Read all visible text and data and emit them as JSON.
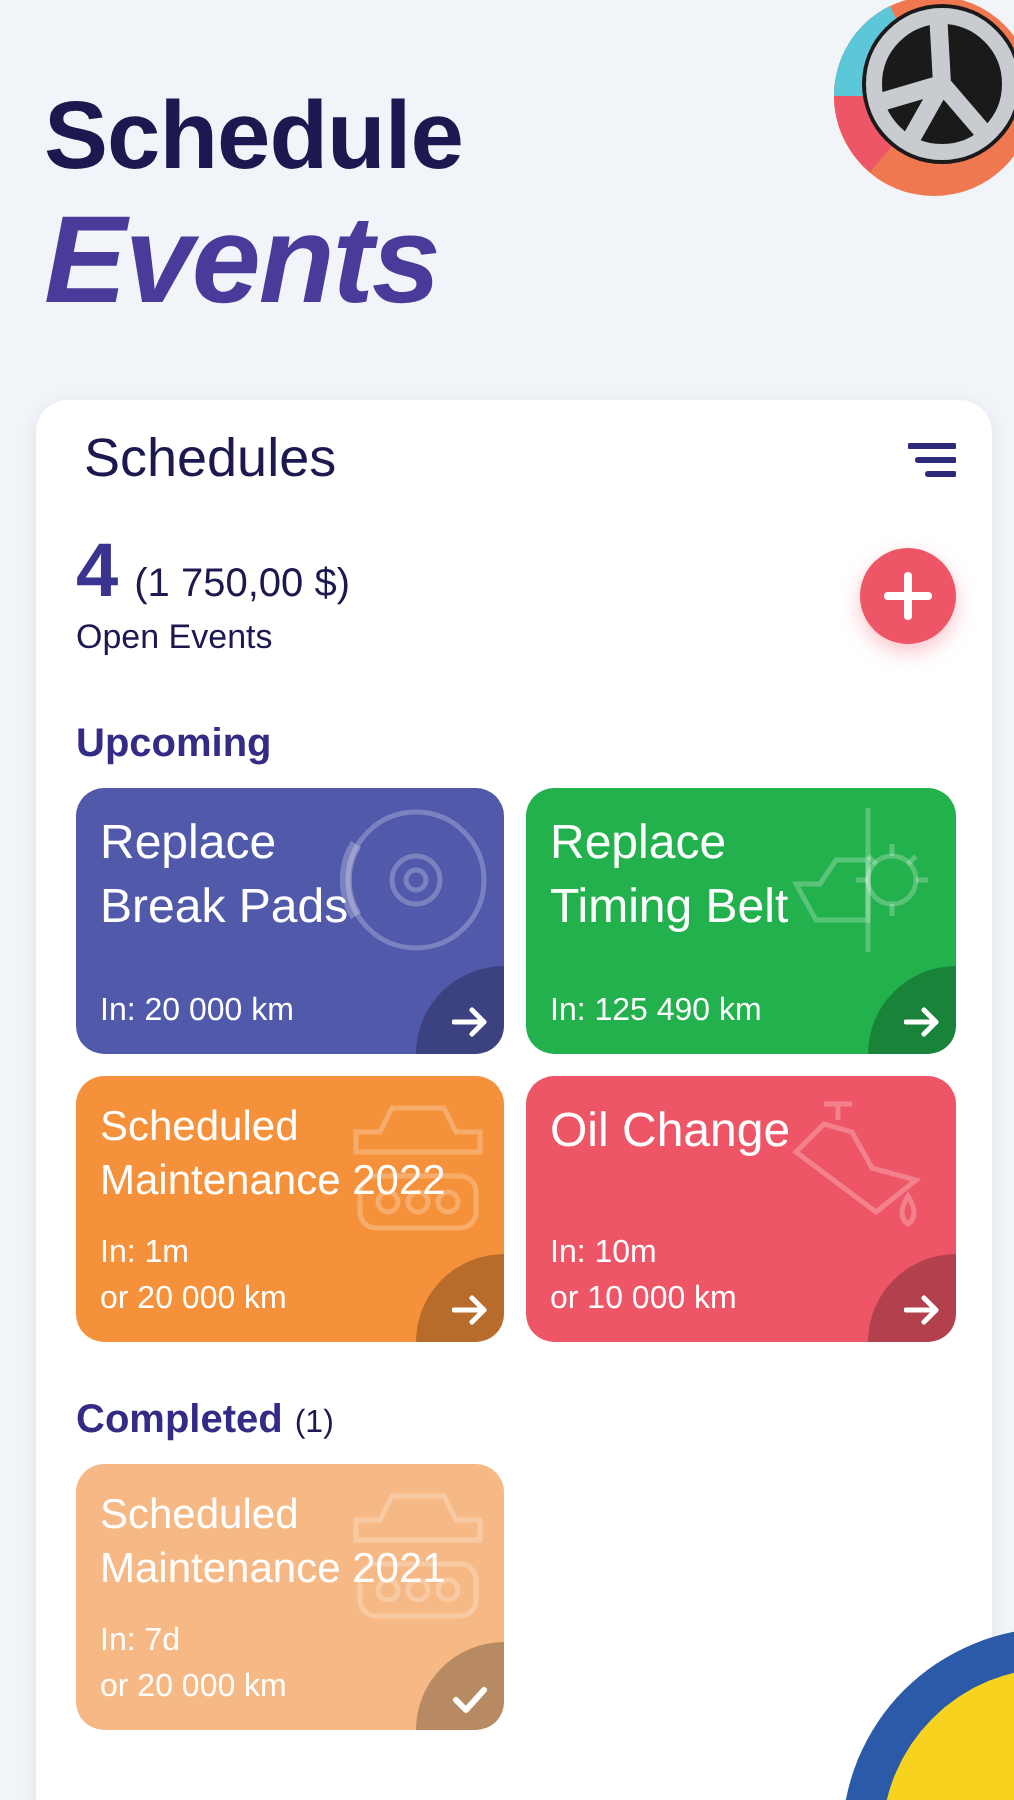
{
  "hero": {
    "line_1": "Schedule",
    "line_2": "Events"
  },
  "panel": {
    "title": "Schedules",
    "count": "4",
    "amount": "(1 750,00 $)",
    "count_label": "Open Events"
  },
  "upcoming": {
    "title": "Upcoming",
    "cards": [
      {
        "kind": "brakes",
        "title": "Replace\nBreak Pads",
        "detail": "In: 20 000 km",
        "color": "#5159ab",
        "done": false
      },
      {
        "kind": "timing",
        "title": "Replace\nTiming Belt",
        "detail": "In: 125 490 km",
        "color": "#22b14c",
        "done": false
      },
      {
        "kind": "maintenance",
        "title": "Scheduled\nMaintenance 2022",
        "detail": "In: 1m\nor 20 000 km",
        "color": "#f5913a",
        "done": false
      },
      {
        "kind": "oil",
        "title": "Oil Change",
        "detail": "In: 10m\nor 10 000 km",
        "color": "#ee5667",
        "done": false
      }
    ]
  },
  "completed": {
    "title": "Completed",
    "count": "(1)",
    "cards": [
      {
        "kind": "maintenance",
        "title": "Scheduled\nMaintenance 2021",
        "detail": "In: 7d\nor 20 000 km",
        "color": "#f6b885",
        "done": true
      }
    ]
  }
}
